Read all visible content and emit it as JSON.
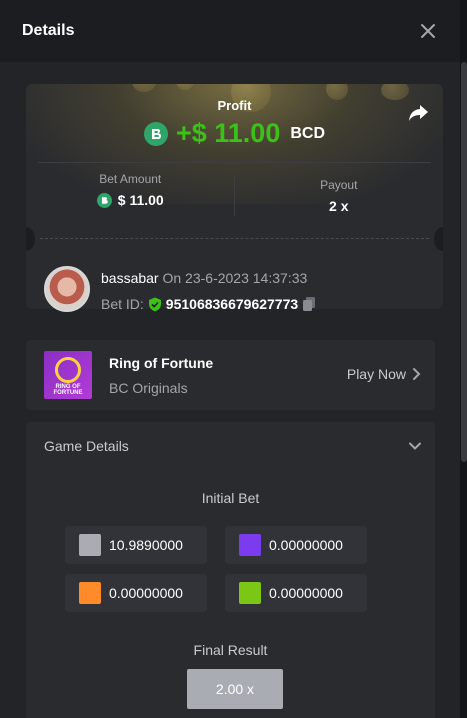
{
  "header": {
    "title": "Details"
  },
  "profit": {
    "label": "Profit",
    "amount": "+$ 11.00",
    "currency": "BCD"
  },
  "stats": {
    "bet_amount_label": "Bet Amount",
    "bet_amount_value": "$ 11.00",
    "payout_label": "Payout",
    "payout_value": "2 x"
  },
  "user": {
    "name": "bassabar",
    "on_text": "On 23-6-2023 14:37:33",
    "bet_id_label": "Bet ID:",
    "bet_id": "95106836679627773"
  },
  "game": {
    "name": "Ring of Fortune",
    "provider": "BC Originals",
    "thumb_text": "RING OF FORTUNE",
    "play_label": "Play Now"
  },
  "game_details": {
    "title": "Game Details",
    "initial_bet_label": "Initial Bet",
    "bets": [
      {
        "color": "#a9adb3",
        "value": "10.9890000"
      },
      {
        "color": "#7b3cf0",
        "value": "0.00000000"
      },
      {
        "color": "#ff8a2a",
        "value": "0.00000000"
      },
      {
        "color": "#7ac716",
        "value": "0.00000000"
      }
    ],
    "final_result_label": "Final Result",
    "final_result": "2.00 x"
  },
  "colors": {
    "profit_green": "#3bc117",
    "bc_green": "#2fa56a",
    "panel": "#2a2b2f"
  },
  "icons": [
    "close-icon",
    "share-icon",
    "bc-coin-icon",
    "verified-shield-icon",
    "copy-icon",
    "chevron-right-icon",
    "chevron-down-icon"
  ]
}
